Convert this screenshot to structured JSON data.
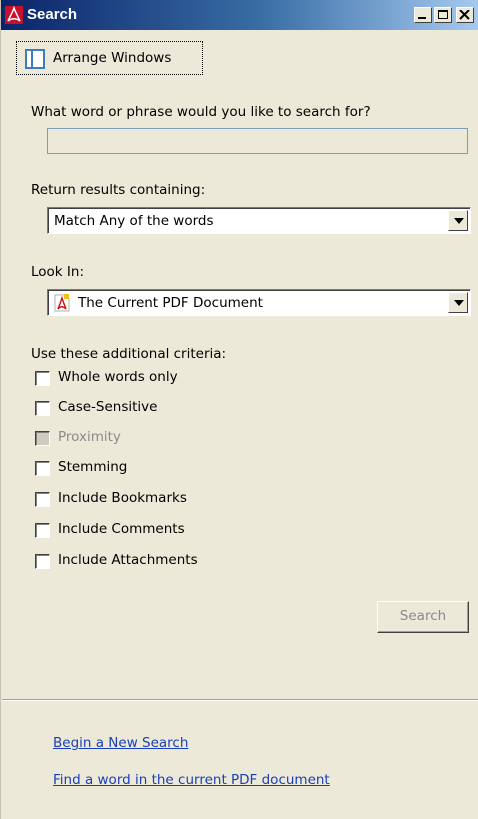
{
  "window": {
    "title": "Search",
    "controls": [
      "minimize",
      "maximize",
      "close"
    ]
  },
  "toolbar": {
    "arrange_label": "Arrange Windows",
    "arrange_icon": "arrange-windows-icon"
  },
  "search_phrase": {
    "label": "What word or phrase would you like to search for?",
    "value": ""
  },
  "return_results": {
    "label": "Return results containing:",
    "selected": "Match Any of the words"
  },
  "look_in": {
    "label": "Look In:",
    "selected": "The Current PDF Document",
    "icon": "pdf-document-icon"
  },
  "criteria": {
    "label": "Use these additional criteria:",
    "items": [
      {
        "label": "Whole words only",
        "checked": false,
        "enabled": true
      },
      {
        "label": "Case-Sensitive",
        "checked": false,
        "enabled": true
      },
      {
        "label": "Proximity",
        "checked": false,
        "enabled": false
      },
      {
        "label": "Stemming",
        "checked": false,
        "enabled": true
      },
      {
        "label": "Include Bookmarks",
        "checked": false,
        "enabled": true
      },
      {
        "label": "Include Comments",
        "checked": false,
        "enabled": true
      },
      {
        "label": "Include Attachments",
        "checked": false,
        "enabled": true
      }
    ]
  },
  "search_button": {
    "label": "Search",
    "enabled": false
  },
  "links": {
    "new_search": "Begin a New Search",
    "find_word": "Find a word in the current PDF document"
  },
  "colors": {
    "title_bar_start": "#0a246a",
    "title_bar_end": "#a6caf0",
    "panel_bg": "#ece9d8",
    "link": "#1a3fb5",
    "disabled_text": "#8a8a8a"
  }
}
